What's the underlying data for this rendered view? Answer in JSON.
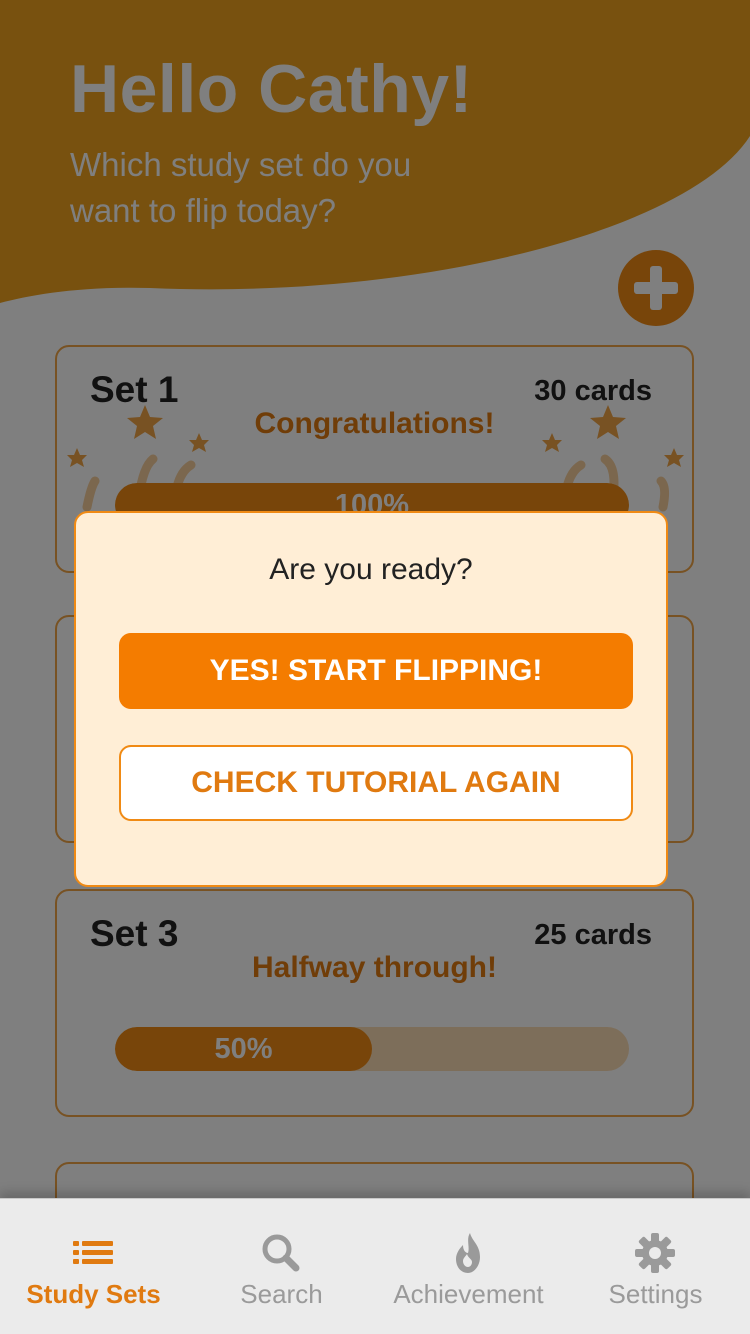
{
  "header": {
    "greeting": "Hello Cathy!",
    "subtitle": "Which study set do you want to flip today?"
  },
  "sets": [
    {
      "title": "Set 1",
      "count": "30 cards",
      "status": "Congratulations!",
      "progress_label": "100%",
      "progress": 1.0
    },
    {
      "title": "Set 3",
      "count": "25 cards",
      "status": "Halfway through!",
      "progress_label": "50%",
      "progress": 0.5
    }
  ],
  "modal": {
    "question": "Are you ready?",
    "primary_label": "YES! START FLIPPING!",
    "secondary_label": "CHECK TUTORIAL AGAIN"
  },
  "nav": {
    "items": [
      {
        "label": "Study Sets",
        "icon": "list-icon",
        "active": true
      },
      {
        "label": "Search",
        "icon": "search-icon",
        "active": false
      },
      {
        "label": "Achievement",
        "icon": "flame-icon",
        "active": false
      },
      {
        "label": "Settings",
        "icon": "gear-icon",
        "active": false
      }
    ]
  },
  "colors": {
    "accent": "#f08a14",
    "primary_button": "#f47c00",
    "modal_bg": "#ffeed6",
    "status_text": "#e07a10"
  }
}
